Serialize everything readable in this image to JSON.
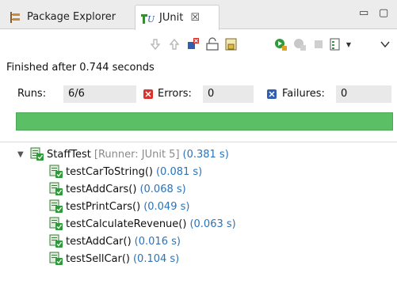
{
  "tabs": [
    {
      "label": "Package Explorer",
      "icon": "package-explorer-icon",
      "active": false
    },
    {
      "label": "JUnit",
      "icon": "junit-icon",
      "active": true,
      "close": "☒"
    }
  ],
  "window_controls": {
    "minimize": "▭",
    "maximize": "▢"
  },
  "toolbar": {
    "buttons": [
      "next-failure-icon",
      "previous-failure-icon",
      "show-failures-only-icon",
      "scroll-lock-icon",
      "show-skipped-icon",
      "rerun-icon",
      "rerun-failed-first-icon",
      "stop-icon",
      "test-run-history-icon",
      "view-menu-icon"
    ]
  },
  "status": "Finished after 0.744 seconds",
  "counters": {
    "runs_label": "Runs:",
    "runs_value": "6/6",
    "errors_label": "Errors:",
    "errors_value": "0",
    "failures_label": "Failures:",
    "failures_value": "0"
  },
  "progress": {
    "fraction": 1.0,
    "color": "#5bbf65"
  },
  "tree": {
    "suite": {
      "name": "StaffTest",
      "runner": "[Runner: JUnit 5]",
      "time": "(0.381 s)"
    },
    "tests": [
      {
        "name": "testCarToString()",
        "time": "(0.081 s)"
      },
      {
        "name": "testAddCars()",
        "time": "(0.068 s)"
      },
      {
        "name": "testPrintCars()",
        "time": "(0.049 s)"
      },
      {
        "name": "testCalculateRevenue()",
        "time": "(0.063 s)"
      },
      {
        "name": "testAddCar()",
        "time": "(0.016 s)"
      },
      {
        "name": "testSellCar()",
        "time": "(0.104 s)"
      }
    ]
  },
  "colors": {
    "time": "#2a73b8",
    "runner": "#8a8a8a",
    "error": "#d9342b",
    "failure": "#2f5fb0"
  }
}
